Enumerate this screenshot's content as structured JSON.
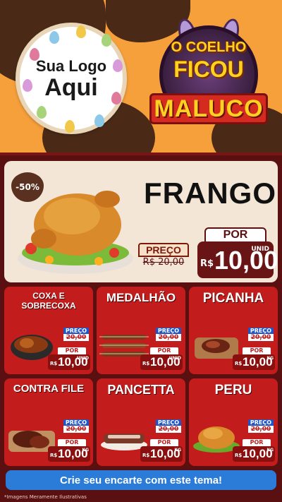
{
  "header": {
    "logo_line1": "Sua Logo",
    "logo_line2": "Aqui",
    "badge_line1": "O COELHO",
    "badge_line2": "FICOU",
    "badge_line3": "MALUCO"
  },
  "feature": {
    "discount": "-50%",
    "name": "FRANGO",
    "preco_label": "PREÇO",
    "old_price": "R$ 20,00",
    "por_label": "POR",
    "currency": "R$",
    "price": "10,00",
    "unit": "UNID"
  },
  "tiles": [
    {
      "title": "COXA E SOBRECOXA",
      "preco_label": "PREÇO",
      "old_price": "20,00",
      "por_label": "POR",
      "currency": "R$",
      "price": "10,00",
      "unit": "UNID"
    },
    {
      "title": "MEDALHÃO",
      "preco_label": "PREÇO",
      "old_price": "20,00",
      "por_label": "POR",
      "currency": "R$",
      "price": "10,00",
      "unit": "UNID"
    },
    {
      "title": "PICANHA",
      "preco_label": "PREÇO",
      "old_price": "20,00",
      "por_label": "POR",
      "currency": "R$",
      "price": "10,00",
      "unit": "KG"
    },
    {
      "title": "CONTRA FILE",
      "preco_label": "PREÇO",
      "old_price": "20,00",
      "por_label": "POR",
      "currency": "R$",
      "price": "10,00",
      "unit": "KG"
    },
    {
      "title": "PANCETTA",
      "preco_label": "PREÇO",
      "old_price": "20,00",
      "por_label": "POR",
      "currency": "R$",
      "price": "10,00",
      "unit": "KG"
    },
    {
      "title": "PERU",
      "preco_label": "PREÇO",
      "old_price": "20,00",
      "por_label": "POR",
      "currency": "R$",
      "price": "10,00",
      "unit": "KG"
    }
  ],
  "cta": "Crie seu encarte com este tema!",
  "footnote": "*Imagens Meramente Ilustrativas",
  "colors": {
    "background_orange": "#f6a03c",
    "brown": "#4a2a17",
    "tile_red": "#c21c1c",
    "dark_red": "#5a1010",
    "cta_blue": "#2b7bd8",
    "badge_yellow": "#ffd21f"
  }
}
